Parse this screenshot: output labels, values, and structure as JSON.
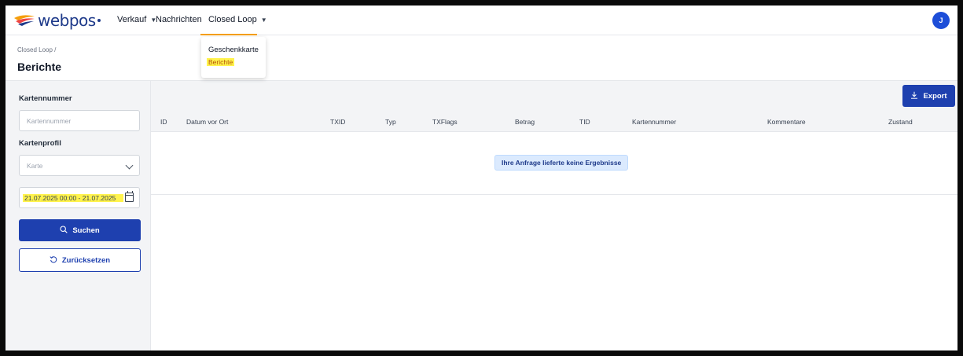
{
  "navbar": {
    "logo_text": "webpos",
    "menu": [
      {
        "label": "Verkauf",
        "has_caret": true
      },
      {
        "label": "Nachrichten",
        "has_caret": false
      },
      {
        "label": "Closed Loop",
        "has_caret": true
      }
    ],
    "avatar_initial": "J",
    "colors": {
      "accent": "#f59e0b",
      "brand": "#1e3a8a",
      "avatar": "#1d4ed8"
    }
  },
  "dropdown": {
    "items": [
      {
        "label": "Geschenkkarte"
      },
      {
        "label": "Berichte",
        "highlighted": true
      }
    ]
  },
  "header": {
    "breadcrumb": "Closed Loop /",
    "title": "Berichte"
  },
  "sidebar": {
    "card_number_label": "Kartennummer",
    "card_number_placeholder": "Kartennummer",
    "card_profile_label": "Kartenprofil",
    "card_profile_value": "Karte",
    "date_range_value": "21.07.2025 00:00 - 21.07.2025",
    "search_label": "Suchen",
    "reset_label": "Zurücksetzen",
    "icons": {
      "search": "search-icon",
      "reset": "reset-icon",
      "calendar": "calendar-icon",
      "select": "chevron-down-icon"
    }
  },
  "main": {
    "export_label": "Export",
    "columns": [
      "ID",
      "Datum vor Ort",
      "TXID",
      "Typ",
      "TXFlags",
      "Betrag",
      "TID",
      "Kartennummer",
      "Kommentare",
      "Zustand"
    ],
    "empty_message": "Ihre Anfrage lieferte keine Ergebnisse",
    "colors": {
      "primary_button": "#1e40af",
      "empty_bg": "#dbeafe"
    }
  }
}
